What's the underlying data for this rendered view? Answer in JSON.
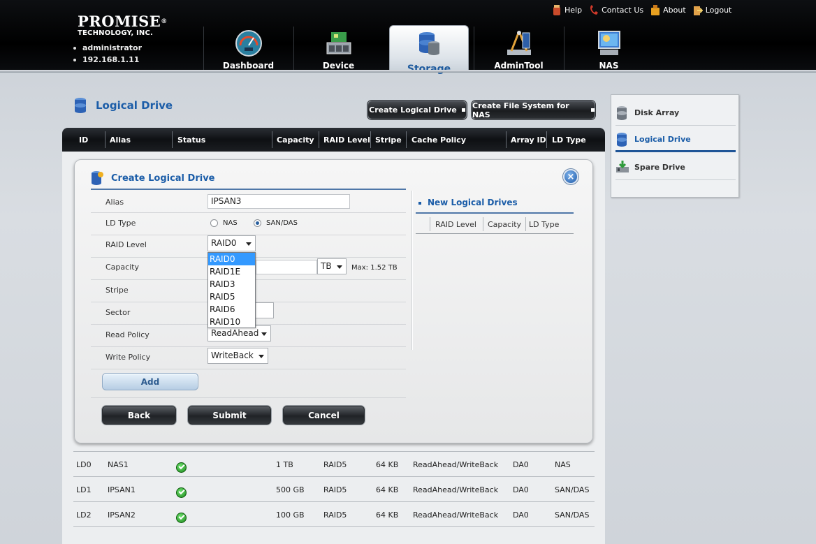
{
  "brand": {
    "name": "PROMISE",
    "registered": "®",
    "sub": "TECHNOLOGY, INC."
  },
  "user": {
    "name": "administrator",
    "ip": "192.168.1.11"
  },
  "toplinks": [
    {
      "label": "Help",
      "icon": "help-icon"
    },
    {
      "label": "Contact Us",
      "icon": "phone-icon"
    },
    {
      "label": "About",
      "icon": "about-icon"
    },
    {
      "label": "Logout",
      "icon": "logout-icon"
    }
  ],
  "nav": [
    {
      "label": "Dashboard",
      "icon": "gauge-icon"
    },
    {
      "label": "Device",
      "icon": "device-icon"
    },
    {
      "label": "Storage",
      "icon": "storage-icon",
      "active": true
    },
    {
      "label": "AdminTool",
      "icon": "admin-tool-icon"
    },
    {
      "label": "NAS",
      "icon": "nas-icon"
    }
  ],
  "page": {
    "title": "Logical Drive"
  },
  "buttons": {
    "create_ld": "Create Logical Drive",
    "create_fs": "Create File System for NAS"
  },
  "table": {
    "columns": [
      "ID",
      "Alias",
      "Status",
      "Capacity",
      "RAID Level",
      "Stripe",
      "Cache Policy",
      "Array ID",
      "LD Type"
    ],
    "rows": [
      {
        "id": "LD0",
        "alias": "NAS1",
        "capacity": "1 TB",
        "raid": "RAID5",
        "stripe": "64 KB",
        "cache": "ReadAhead/WriteBack",
        "array": "DA0",
        "type": "NAS"
      },
      {
        "id": "LD1",
        "alias": "IPSAN1",
        "capacity": "500 GB",
        "raid": "RAID5",
        "stripe": "64 KB",
        "cache": "ReadAhead/WriteBack",
        "array": "DA0",
        "type": "SAN/DAS"
      },
      {
        "id": "LD2",
        "alias": "IPSAN2",
        "capacity": "100 GB",
        "raid": "RAID5",
        "stripe": "64 KB",
        "cache": "ReadAhead/WriteBack",
        "array": "DA0",
        "type": "SAN/DAS"
      }
    ]
  },
  "dialog": {
    "title": "Create Logical Drive",
    "close": "×",
    "labels": {
      "alias": "Alias",
      "ld_type": "LD Type",
      "raid_level": "RAID Level",
      "capacity": "Capacity",
      "stripe": "Stripe",
      "sector": "Sector",
      "read_policy": "Read Policy",
      "write_policy": "Write Policy"
    },
    "alias_value": "IPSAN3",
    "ld_type_options": [
      "NAS",
      "SAN/DAS"
    ],
    "ld_type_selected": "SAN/DAS",
    "raid_level_value": "RAID0",
    "raid_options": [
      "RAID0",
      "RAID1E",
      "RAID3",
      "RAID5",
      "RAID6",
      "RAID10"
    ],
    "capacity_unit": "TB",
    "capacity_max": "Max: 1.52 TB",
    "read_policy_value": "ReadAhead",
    "write_policy_value": "WriteBack",
    "add": "Add",
    "back": "Back",
    "submit": "Submit",
    "cancel": "Cancel",
    "new_ld": {
      "title": "New Logical Drives",
      "columns": [
        "RAID Level",
        "Capacity",
        "LD Type"
      ]
    }
  },
  "side": [
    {
      "label": "Disk Array"
    },
    {
      "label": "Logical Drive",
      "active": true
    },
    {
      "label": "Spare Drive"
    }
  ]
}
